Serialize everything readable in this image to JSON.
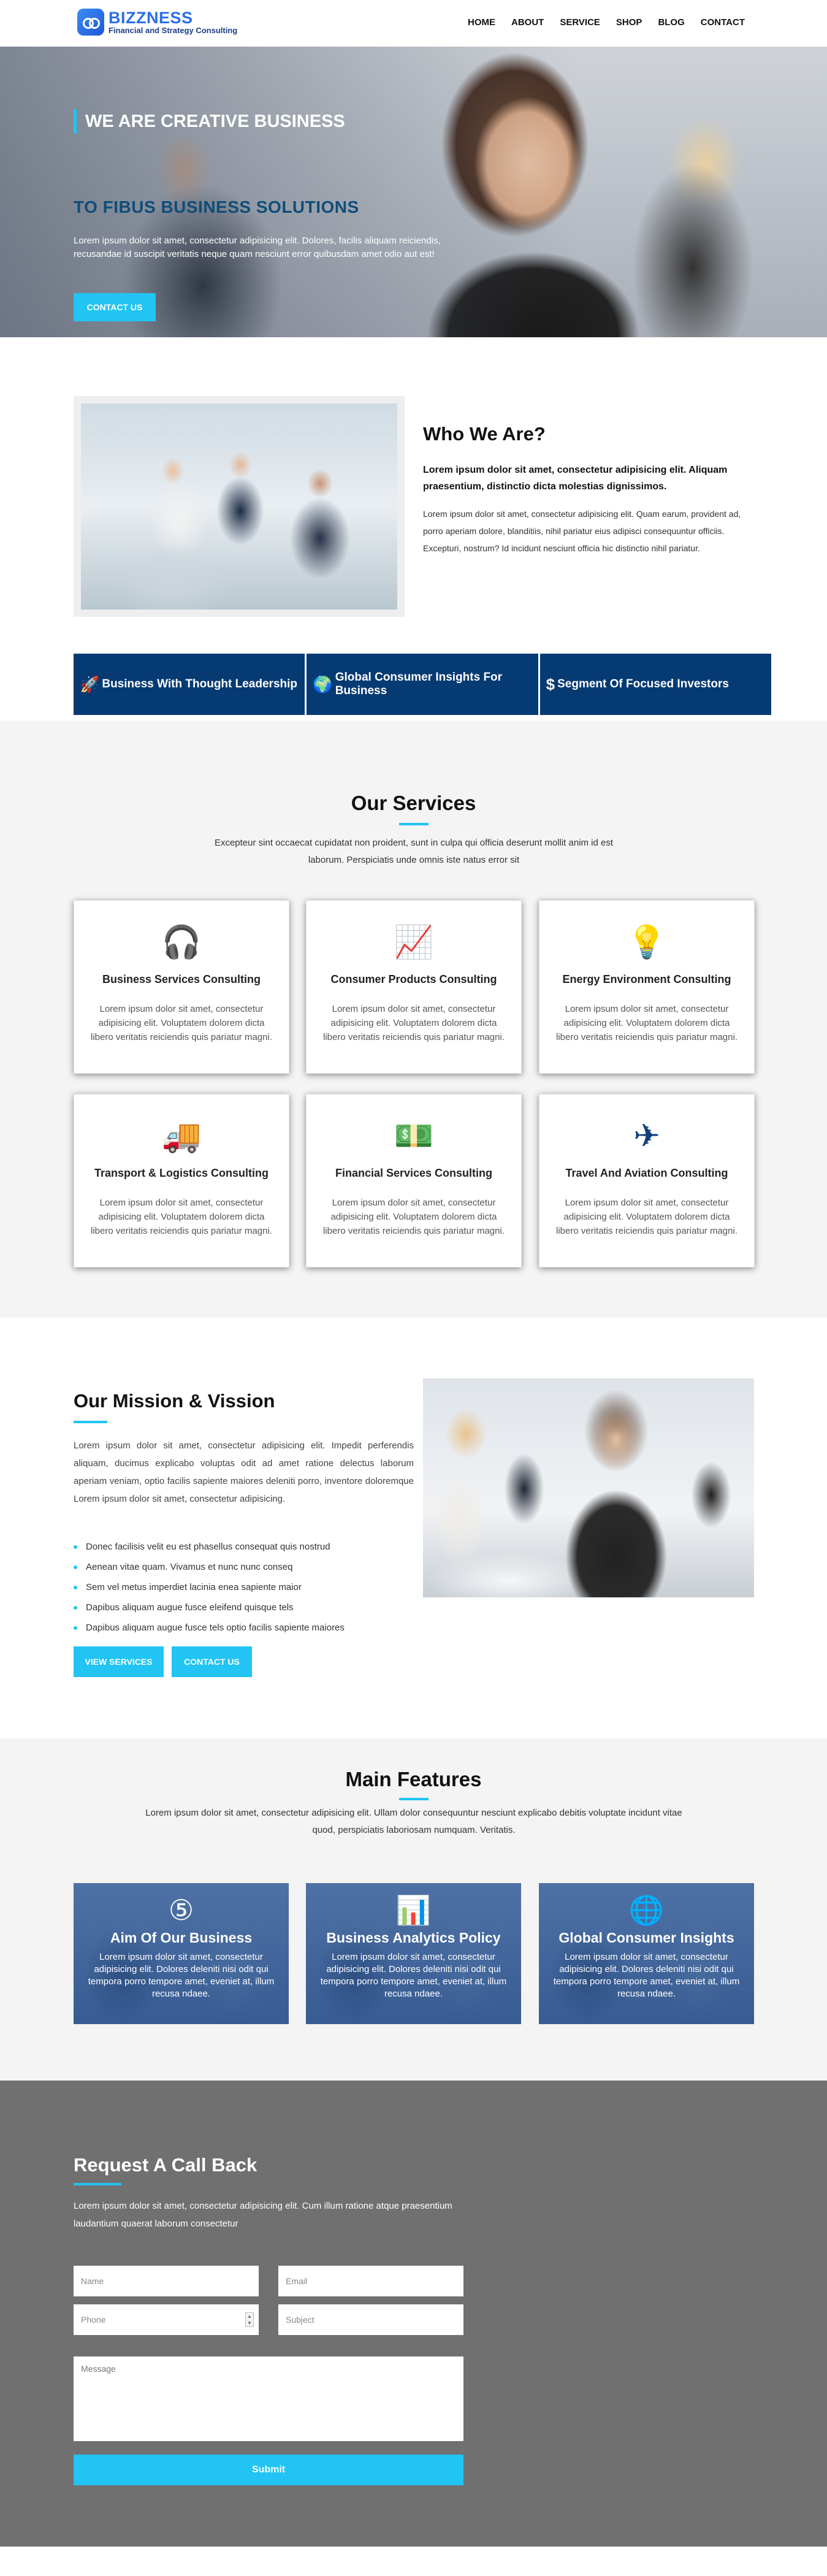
{
  "brand": {
    "name": "BIZZNESS",
    "tagline": "Financial and Strategy Consulting"
  },
  "nav": [
    "HOME",
    "ABOUT",
    "SERVICE",
    "SHOP",
    "BLOG",
    "CONTACT"
  ],
  "hero": {
    "title": "WE ARE CREATIVE BUSINESS",
    "subtitle": "TO FIBUS BUSINESS SOLUTIONS",
    "text": "Lorem ipsum dolor sit amet, consectetur adipisicing elit. Dolores, facilis aliquam reiciendis, recusandae id suscipit veritatis neque quam nesciunt error quibusdam amet odio aut est!",
    "cta": "CONTACT US"
  },
  "who": {
    "title": "Who We Are?",
    "lead": "Lorem ipsum dolor sit amet, consectetur adipisicing elit. Aliquam praesentium, distinctio dicta molestias dignissimos.",
    "body": "Lorem ipsum dolor sit amet, consectetur adipisicing elit. Quam earum, provident ad, porro aperiam dolore, blanditiis, nihil pariatur eius adipisci consequuntur officiis. Excepturi, nostrum? Id incidunt nesciunt officia hic distinctio nihil pariatur."
  },
  "strip": [
    {
      "icon": "rocket-icon",
      "glyph": "🚀",
      "label": "Business With Thought Leadership"
    },
    {
      "icon": "globe-icon",
      "glyph": "🌍",
      "label": "Global Consumer Insights For Business"
    },
    {
      "icon": "dollar-icon",
      "glyph": "$",
      "label": "Segment Of Focused Investors"
    }
  ],
  "services": {
    "title": "Our Services",
    "text": "Excepteur sint occaecat cupidatat non proident, sunt in culpa qui officia deserunt mollit anim id est laborum. Perspiciatis unde omnis iste natus error sit",
    "cards": [
      {
        "icon": "headset-icon",
        "glyph": "🎧",
        "title": "Business Services Consulting",
        "text": "Lorem ipsum dolor sit amet, consectetur adipisicing elit. Voluptatem dolorem dicta libero veritatis reiciendis quis pariatur magni."
      },
      {
        "icon": "chart-icon",
        "glyph": "📈",
        "title": "Consumer Products Consulting",
        "text": "Lorem ipsum dolor sit amet, consectetur adipisicing elit. Voluptatem dolorem dicta libero veritatis reiciendis quis pariatur magni."
      },
      {
        "icon": "lightbulb-icon",
        "glyph": "💡",
        "title": "Energy Environment Consulting",
        "text": "Lorem ipsum dolor sit amet, consectetur adipisicing elit. Voluptatem dolorem dicta libero veritatis reiciendis quis pariatur magni."
      },
      {
        "icon": "truck-icon",
        "glyph": "🚚",
        "title": "Transport & Logistics Consulting",
        "text": "Lorem ipsum dolor sit amet, consectetur adipisicing elit. Voluptatem dolorem dicta libero veritatis reiciendis quis pariatur magni."
      },
      {
        "icon": "money-icon",
        "glyph": "💵",
        "title": "Financial Services Consulting",
        "text": "Lorem ipsum dolor sit amet, consectetur adipisicing elit. Voluptatem dolorem dicta libero veritatis reiciendis quis pariatur magni."
      },
      {
        "icon": "airplane-icon",
        "glyph": "✈",
        "title": "Travel And Aviation Consulting",
        "text": "Lorem ipsum dolor sit amet, consectetur adipisicing elit. Voluptatem dolorem dicta libero veritatis reiciendis quis pariatur magni."
      }
    ]
  },
  "mission": {
    "title": "Our Mission & Vission",
    "text": "Lorem ipsum dolor sit amet, consectetur adipisicing elit. Impedit perferendis aliquam, ducimus explicabo voluptas odit ad amet ratione delectus laborum aperiam veniam, optio facilis sapiente maiores deleniti porro, inventore doloremque Lorem ipsum dolor sit amet, consectetur adipisicing.",
    "list": [
      "Donec facilisis velit eu est phasellus consequat quis nostrud",
      "Aenean vitae quam. Vivamus et nunc nunc conseq",
      "Sem vel metus imperdiet lacinia enea sapiente maior",
      "Dapibus aliquam augue fusce eleifend quisque tels",
      "Dapibus aliquam augue fusce tels optio facilis sapiente maiores"
    ],
    "btn_services": "VIEW SERVICES",
    "btn_contact": "CONTACT US"
  },
  "features": {
    "title": "Main Features",
    "text": "Lorem ipsum dolor sit amet, consectetur adipisicing elit. Ullam dolor consequuntur nesciunt explicabo debitis voluptate incidunt vitae quod, perspiciatis laboriosam numquam. Veritatis.",
    "items": [
      {
        "icon": "number-five-icon",
        "glyph": "⑤",
        "title": "Aim Of Our Business",
        "text": "Lorem ipsum dolor sit amet, consectetur adipisicing elit. Dolores deleniti nisi odit qui tempora porro tempore amet, eveniet at, illum recusa ndaee."
      },
      {
        "icon": "analytics-icon",
        "glyph": "📊",
        "title": "Business Analytics Policy",
        "text": "Lorem ipsum dolor sit amet, consectetur adipisicing elit. Dolores deleniti nisi odit qui tempora porro tempore amet, eveniet at, illum recusa ndaee."
      },
      {
        "icon": "globe-icon",
        "glyph": "🌐",
        "title": "Global Consumer Insights",
        "text": "Lorem ipsum dolor sit amet, consectetur adipisicing elit. Dolores deleniti nisi odit qui tempora porro tempore amet, eveniet at, illum recusa ndaee."
      }
    ]
  },
  "callback": {
    "title": "Request A Call Back",
    "text": "Lorem ipsum dolor sit amet, consectetur adipisicing elit. Cum illum ratione atque praesentium laudantium quaerat laborum consectetur",
    "name_placeholder": "Name",
    "email_placeholder": "Email",
    "phone_placeholder": "Phone",
    "subject_placeholder": "Subject",
    "message_placeholder": "Message",
    "submit": "Submit"
  },
  "colors": {
    "accent": "#21c4f2",
    "navy": "#063a73",
    "brand": "#2b6fe3",
    "footer_bg": "#707070"
  }
}
